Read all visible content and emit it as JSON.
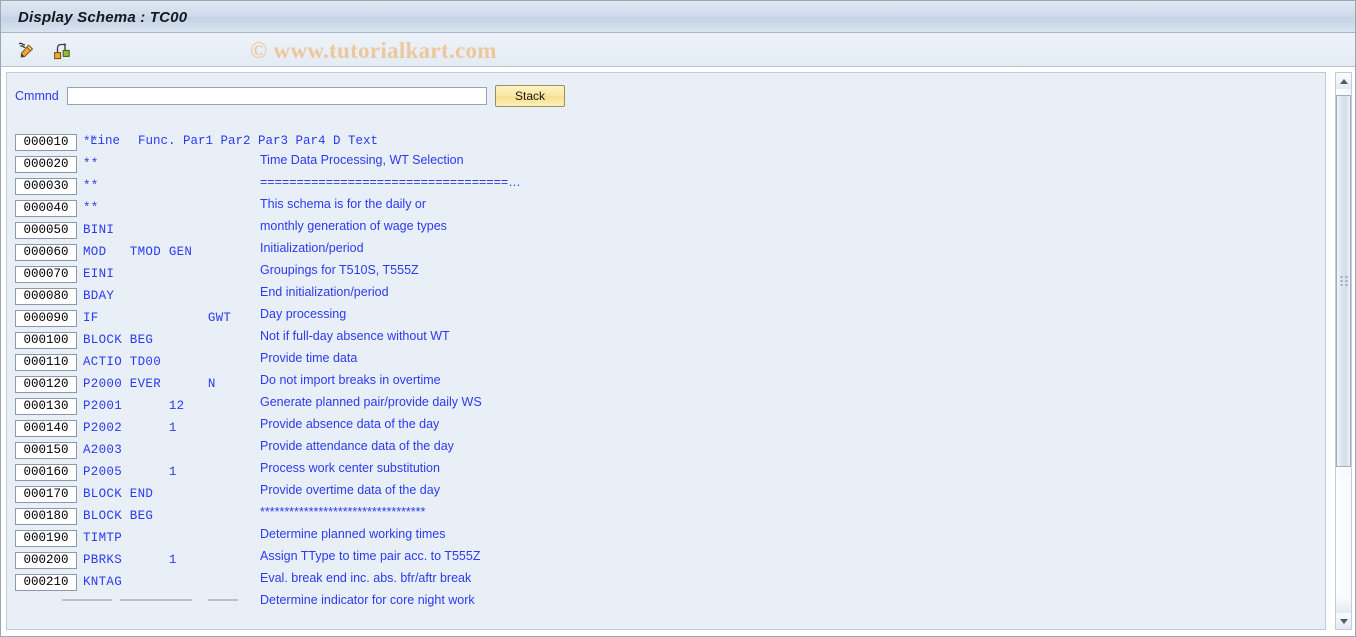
{
  "window": {
    "title": "Display Schema : TC00"
  },
  "watermark": {
    "text": "© www.tutorialkart.com"
  },
  "toolbar": {
    "buttons": [
      {
        "name": "display-change-icon",
        "tooltip": "Display <-> Change"
      },
      {
        "name": "structure-hierarchy-icon",
        "tooltip": "Structure"
      }
    ]
  },
  "command_row": {
    "label": "Cmmnd",
    "input_value": "",
    "input_placeholder": "",
    "stack_label": "Stack"
  },
  "grid": {
    "headers": {
      "line": "Line",
      "func": "Func.",
      "par1": "Par1",
      "par2": "Par2",
      "par3": "Par3",
      "par4": "Par4",
      "d": "D",
      "text": "Text"
    },
    "header_code_line": "Func. Par1 Par2 Par3 Par4 D Text",
    "rows": [
      {
        "line": "000010",
        "func": "**",
        "par1": "",
        "par2": "",
        "par3": "",
        "par4": "",
        "d": "",
        "text": "Time Data Processing, WT Selection"
      },
      {
        "line": "000020",
        "func": "**",
        "par1": "",
        "par2": "",
        "par3": "",
        "par4": "",
        "d": "",
        "text": "==================================…"
      },
      {
        "line": "000030",
        "func": "**",
        "par1": "",
        "par2": "",
        "par3": "",
        "par4": "",
        "d": "",
        "text": "This schema is for the daily or"
      },
      {
        "line": "000040",
        "func": "**",
        "par1": "",
        "par2": "",
        "par3": "",
        "par4": "",
        "d": "",
        "text": "monthly generation of wage types"
      },
      {
        "line": "000050",
        "func": "BINI",
        "par1": "",
        "par2": "",
        "par3": "",
        "par4": "",
        "d": "",
        "text": "Initialization/period"
      },
      {
        "line": "000060",
        "func": "MOD",
        "par1": "TMOD",
        "par2": "GEN",
        "par3": "",
        "par4": "",
        "d": "",
        "text": "Groupings for T510S, T555Z"
      },
      {
        "line": "000070",
        "func": "EINI",
        "par1": "",
        "par2": "",
        "par3": "",
        "par4": "",
        "d": "",
        "text": "End initialization/period"
      },
      {
        "line": "000080",
        "func": "BDAY",
        "par1": "",
        "par2": "",
        "par3": "",
        "par4": "",
        "d": "",
        "text": "Day processing"
      },
      {
        "line": "000090",
        "func": "IF",
        "par1": "",
        "par2": "",
        "par3": "GWT",
        "par4": "",
        "d": "",
        "text": "Not if full-day absence without WT"
      },
      {
        "line": "000100",
        "func": "BLOCK",
        "par1": "BEG",
        "par2": "",
        "par3": "",
        "par4": "",
        "d": "",
        "text": "Provide time data"
      },
      {
        "line": "000110",
        "func": "ACTIO",
        "par1": "TD00",
        "par2": "",
        "par3": "",
        "par4": "",
        "d": "",
        "text": "Do not import breaks in overtime"
      },
      {
        "line": "000120",
        "func": "P2000",
        "par1": "EVER",
        "par2": "",
        "par3": "N",
        "par4": "",
        "d": "",
        "text": "Generate planned pair/provide daily WS"
      },
      {
        "line": "000130",
        "func": "P2001",
        "par1": "",
        "par2": "12",
        "par3": "",
        "par4": "",
        "d": "",
        "text": "Provide absence data of the day"
      },
      {
        "line": "000140",
        "func": "P2002",
        "par1": "",
        "par2": "1",
        "par3": "",
        "par4": "",
        "d": "",
        "text": "Provide attendance data of the day"
      },
      {
        "line": "000150",
        "func": "A2003",
        "par1": "",
        "par2": "",
        "par3": "",
        "par4": "",
        "d": "",
        "text": "Process work center substitution"
      },
      {
        "line": "000160",
        "func": "P2005",
        "par1": "",
        "par2": "1",
        "par3": "",
        "par4": "",
        "d": "",
        "text": "Provide overtime data of the day"
      },
      {
        "line": "000170",
        "func": "BLOCK",
        "par1": "END",
        "par2": "",
        "par3": "",
        "par4": "",
        "d": "",
        "text": "**********************************"
      },
      {
        "line": "000180",
        "func": "BLOCK",
        "par1": "BEG",
        "par2": "",
        "par3": "",
        "par4": "",
        "d": "",
        "text": "Determine planned working times"
      },
      {
        "line": "000190",
        "func": "TIMTP",
        "par1": "",
        "par2": "",
        "par3": "",
        "par4": "",
        "d": "",
        "text": "Assign TType to time pair acc. to T555Z"
      },
      {
        "line": "000200",
        "func": "PBRKS",
        "par1": "",
        "par2": "1",
        "par3": "",
        "par4": "",
        "d": "",
        "text": "Eval. break end inc. abs. bfr/aftr break"
      },
      {
        "line": "000210",
        "func": "KNTAG",
        "par1": "",
        "par2": "",
        "par3": "",
        "par4": "",
        "d": "",
        "text": "Determine indicator for core night work"
      }
    ]
  },
  "scrollbar": {
    "up_arrow": "▲",
    "down_arrow": "▼"
  },
  "colors": {
    "text_blue": "#2b3af0",
    "title_bar_start": "#dfe8f3",
    "panel_bg": "#e9eff7",
    "stack_button": "#f7df8c",
    "watermark": "#f0b97a"
  }
}
